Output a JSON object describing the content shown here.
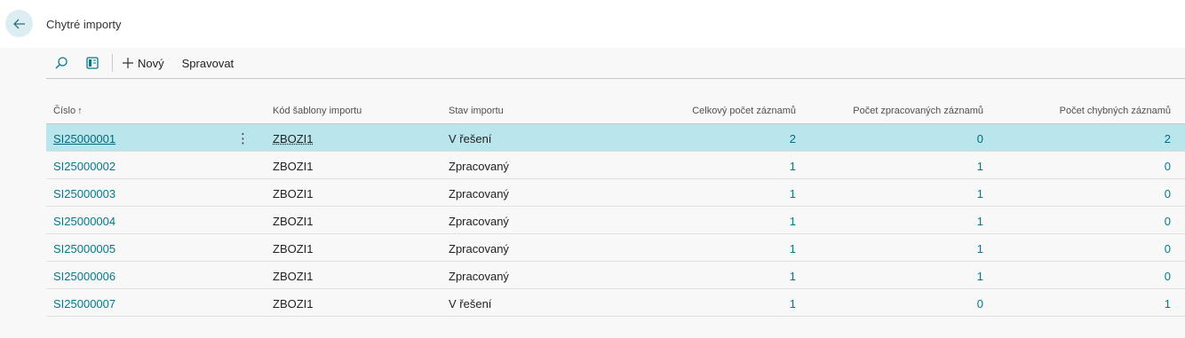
{
  "header": {
    "title": "Chytré importy"
  },
  "toolbar": {
    "new_label": "Nový",
    "manage_label": "Spravovat"
  },
  "columns": {
    "number": "Číslo",
    "template": "Kód šablony importu",
    "status": "Stav importu",
    "total": "Celkový počet záznamů",
    "processed": "Počet zpracovaných záznamů",
    "errors": "Počet chybných záznamů"
  },
  "rows": [
    {
      "number": "SI25000001",
      "template": "ZBOZI1",
      "status": "V řešení",
      "total": "2",
      "processed": "0",
      "errors": "2"
    },
    {
      "number": "SI25000002",
      "template": "ZBOZI1",
      "status": "Zpracovaný",
      "total": "1",
      "processed": "1",
      "errors": "0"
    },
    {
      "number": "SI25000003",
      "template": "ZBOZI1",
      "status": "Zpracovaný",
      "total": "1",
      "processed": "1",
      "errors": "0"
    },
    {
      "number": "SI25000004",
      "template": "ZBOZI1",
      "status": "Zpracovaný",
      "total": "1",
      "processed": "1",
      "errors": "0"
    },
    {
      "number": "SI25000005",
      "template": "ZBOZI1",
      "status": "Zpracovaný",
      "total": "1",
      "processed": "1",
      "errors": "0"
    },
    {
      "number": "SI25000006",
      "template": "ZBOZI1",
      "status": "Zpracovaný",
      "total": "1",
      "processed": "1",
      "errors": "0"
    },
    {
      "number": "SI25000007",
      "template": "ZBOZI1",
      "status": "V řešení",
      "total": "1",
      "processed": "0",
      "errors": "1"
    }
  ],
  "colors": {
    "accent": "#007a8f",
    "selected_row": "#b8e6ec",
    "back_button": "#ddeef2"
  }
}
